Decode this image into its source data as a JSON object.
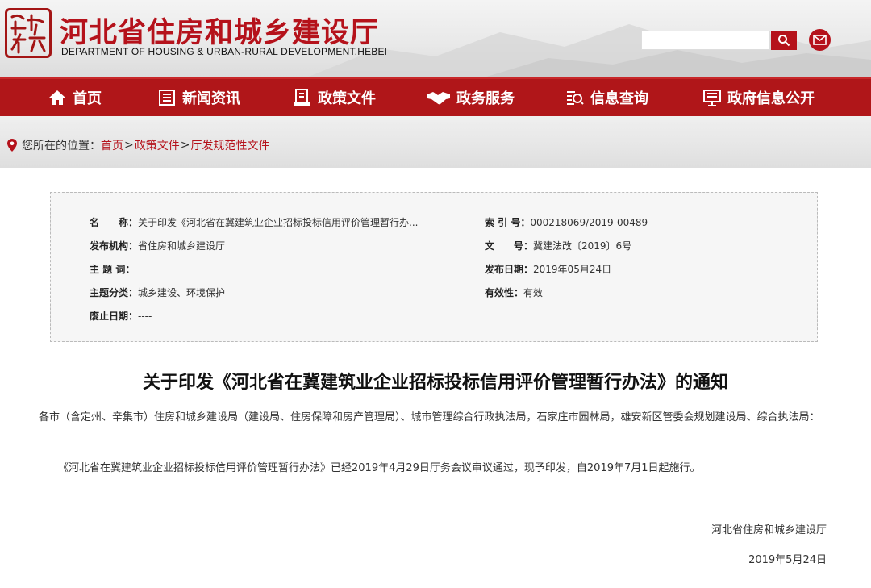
{
  "header": {
    "title": "河北省住房和城乡建设厅",
    "subtitle": "DEPARTMENT OF HOUSING & URBAN-RURAL DEVELOPMENT.HEBEI",
    "search": {
      "placeholder": ""
    },
    "icons": {
      "search": "search-icon",
      "mail": "mail-icon",
      "logo": "seal-logo"
    }
  },
  "nav": {
    "items": [
      {
        "label": "首页",
        "icon": "home-icon"
      },
      {
        "label": "新闻资讯",
        "icon": "news-icon"
      },
      {
        "label": "政策文件",
        "icon": "policy-icon"
      },
      {
        "label": "政务服务",
        "icon": "handshake-icon"
      },
      {
        "label": "信息查询",
        "icon": "query-icon"
      },
      {
        "label": "政府信息公开",
        "icon": "disclosure-icon"
      }
    ]
  },
  "breadcrumb": {
    "prefix": "您所在的位置：",
    "items": [
      "首页",
      "政策文件",
      "厅发规范性文件"
    ],
    "separator": ">"
  },
  "info": {
    "name_label": "名　　称：",
    "name_value": "关于印发《河北省在冀建筑业企业招标投标信用评价管理暂行办...",
    "index_label": "索 引 号：",
    "index_value": "000218069/2019-00489",
    "publisher_label": "发布机构：",
    "publisher_value": "省住房和城乡建设厅",
    "docno_label": "文　　号：",
    "docno_value": "冀建法改〔2019〕6号",
    "keyword_label": "主 题 词：",
    "keyword_value": "",
    "date_label": "发布日期：",
    "date_value": "2019年05月24日",
    "category_label": "主题分类：",
    "category_value": "城乡建设、环境保护",
    "validity_label": "有效性：",
    "validity_value": "有效",
    "expire_label": "废止日期：",
    "expire_value": "----"
  },
  "article": {
    "title": "关于印发《河北省在冀建筑业企业招标投标信用评价管理暂行办法》的通知",
    "recipients": "各市（含定州、辛集市）住房和城乡建设局（建设局、住房保障和房产管理局）、城市管理综合行政执法局，石家庄市园林局，雄安新区管委会规划建设局、综合执法局：",
    "body": "《河北省在冀建筑业企业招标投标信用评价管理暂行办法》已经2019年4月29日厅务会议审议通过，现予印发，自2019年7月1日起施行。",
    "signature": "河北省住房和城乡建设厅",
    "sign_date": "2019年5月24日"
  },
  "colors": {
    "brand_red": "#b01619",
    "link_red": "#b5121b"
  }
}
